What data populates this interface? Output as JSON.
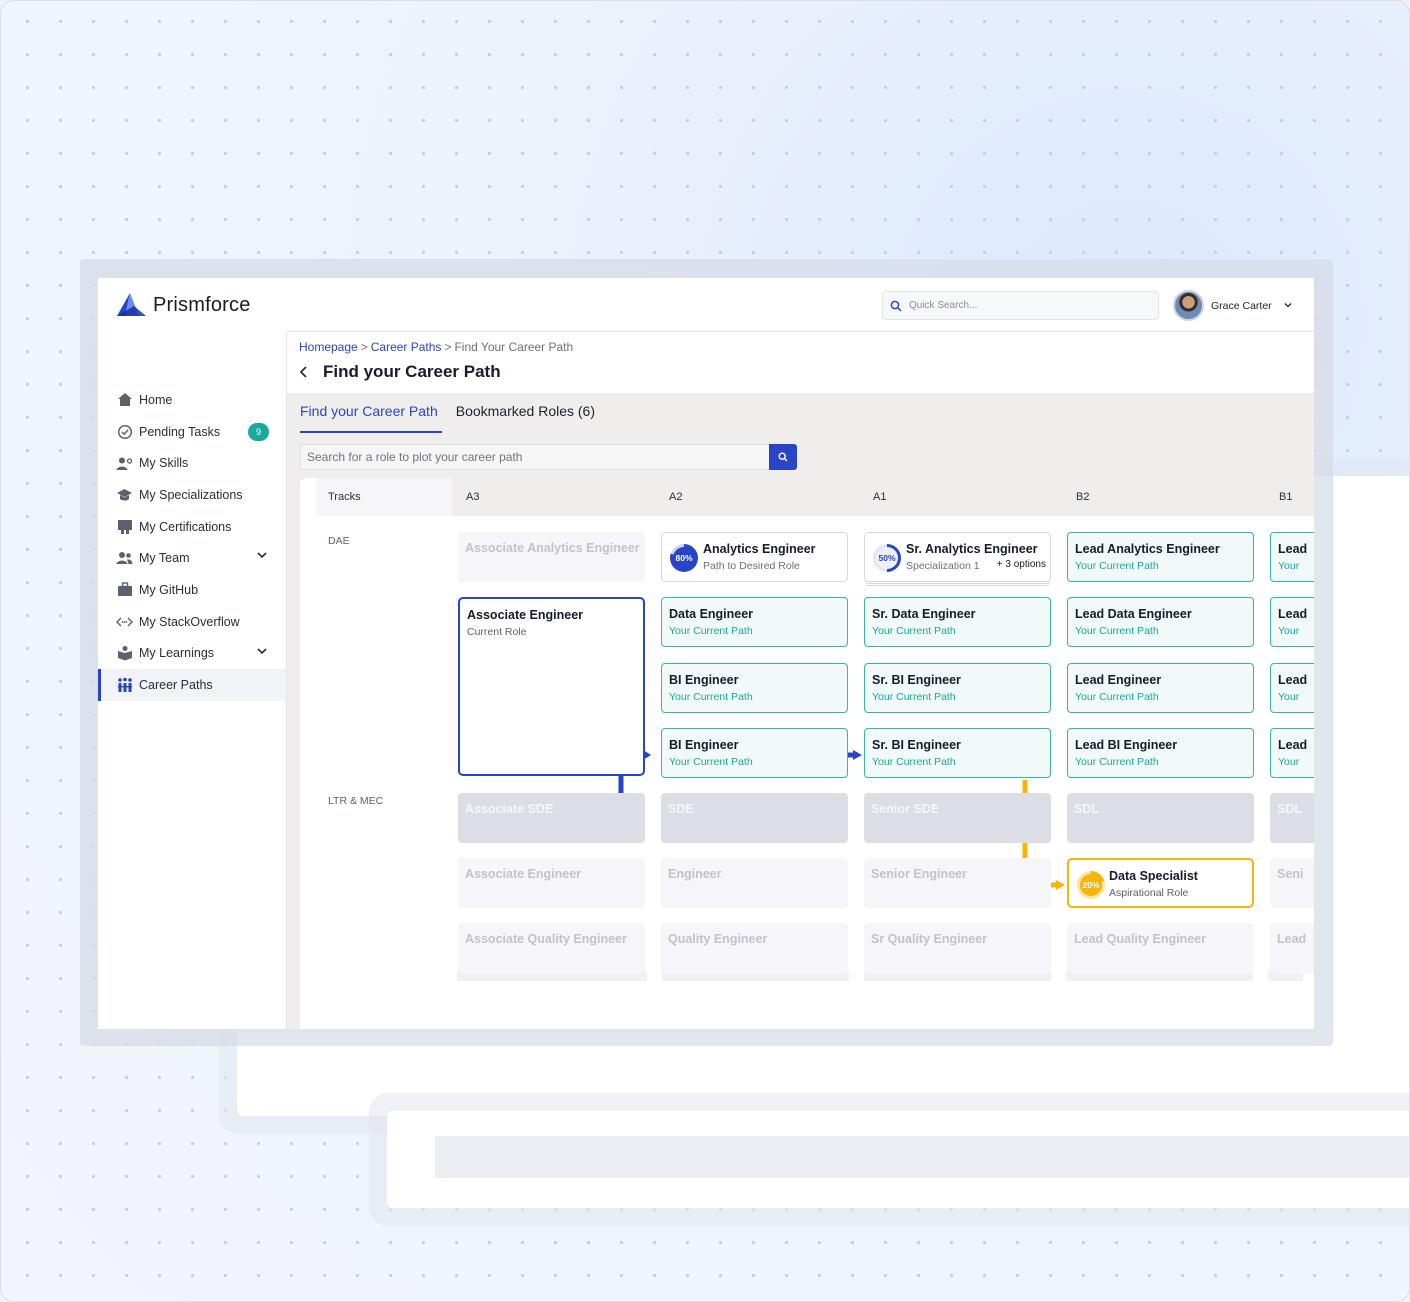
{
  "app": {
    "name": "Prismforce",
    "brand_color": "#2845c9"
  },
  "header": {
    "search_placeholder": "Quick Search...",
    "user_name": "Grace Carter"
  },
  "sidebar": {
    "items": [
      {
        "label": "Home",
        "icon": "home-icon"
      },
      {
        "label": "Pending Tasks",
        "icon": "check-circle-icon",
        "badge": "9"
      },
      {
        "label": "My Skills",
        "icon": "user-skills-icon"
      },
      {
        "label": "My Specializations",
        "icon": "graduation-cap-icon"
      },
      {
        "label": "My Certifications",
        "icon": "certificate-icon"
      },
      {
        "label": "My Team",
        "icon": "team-icon",
        "expandable": true
      },
      {
        "label": "My GitHub",
        "icon": "briefcase-icon"
      },
      {
        "label": "My StackOverflow",
        "icon": "code-icon"
      },
      {
        "label": "My Learnings",
        "icon": "learning-icon",
        "expandable": true
      },
      {
        "label": "Career Paths",
        "icon": "career-paths-icon",
        "active": true
      }
    ]
  },
  "breadcrumb": {
    "home": "Homepage",
    "career_paths": "Career Paths",
    "current": "Find Your Career Path",
    "separator": ">"
  },
  "page": {
    "title": "Find your Career Path"
  },
  "tabs": [
    {
      "label": "Find your Career Path",
      "active": true
    },
    {
      "label": "Bookmarked Roles (6)",
      "active": false
    }
  ],
  "role_search": {
    "placeholder": "Search for a role to plot your career path"
  },
  "grid": {
    "tracks_header": "Tracks",
    "columns": [
      "A3",
      "A2",
      "A1",
      "B2",
      "B1"
    ],
    "tracks": [
      "DAE",
      "LTR & MEC"
    ],
    "cards": {
      "dae_r1": [
        {
          "title": "Associate Analytics Engineer",
          "style": "faded"
        },
        {
          "title": "Analytics Engineer",
          "subtitle": "Path to Desired Role",
          "progress": "80%",
          "style": "plain"
        },
        {
          "title": "Sr. Analytics Engineer",
          "subtitle": "Specialization 1",
          "extra": "+ 3 options",
          "progress": "50%",
          "style": "plain-stack"
        },
        {
          "title": "Lead Analytics Engineer",
          "subtitle": "Your Current Path",
          "style": "path"
        },
        {
          "title": "Lead",
          "subtitle": "Your",
          "style": "path"
        }
      ],
      "current": {
        "title": "Associate Engineer",
        "subtitle": "Current Role"
      },
      "dae_r2": [
        {
          "title": "Data Engineer",
          "subtitle": "Your Current Path"
        },
        {
          "title": "Sr. Data  Engineer",
          "subtitle": "Your Current Path"
        },
        {
          "title": "Lead Data Engineer",
          "subtitle": "Your Current Path"
        },
        {
          "title": "Lead",
          "subtitle": "Your"
        }
      ],
      "dae_r3": [
        {
          "title": "BI Engineer",
          "subtitle": "Your Current Path"
        },
        {
          "title": "Sr. BI Engineer",
          "subtitle": "Your Current Path"
        },
        {
          "title": "Lead Engineer",
          "subtitle": "Your Current Path"
        },
        {
          "title": "Lead",
          "subtitle": "Your"
        }
      ],
      "dae_r4": [
        {
          "title": "BI Engineer",
          "subtitle": "Your Current Path"
        },
        {
          "title": "Sr. BI Engineer",
          "subtitle": "Your Current Path"
        },
        {
          "title": "Lead BI Engineer",
          "subtitle": "Your Current Path"
        },
        {
          "title": "Lead",
          "subtitle": "Your"
        }
      ],
      "ltr_r1": [
        "Associate SDE",
        "SDE",
        "Senior SDE",
        "SDL",
        "SDL"
      ],
      "ltr_r2": [
        "Associate Engineer",
        "Engineer",
        "Senior Engineer",
        "Seni"
      ],
      "aspirational": {
        "title": "Data Specialist",
        "subtitle": "Aspirational Role",
        "progress": "20%"
      },
      "ltr_r3": [
        "Associate Quality Engineer",
        "Quality Engineer",
        "Sr Quality Engineer",
        "Lead Quality Engineer",
        "Lead"
      ]
    },
    "colors": {
      "path_border": "#38b6a5",
      "path_text": "#1aa99a",
      "current_border": "#2845c9",
      "aspiration": "#f5b50a"
    }
  }
}
